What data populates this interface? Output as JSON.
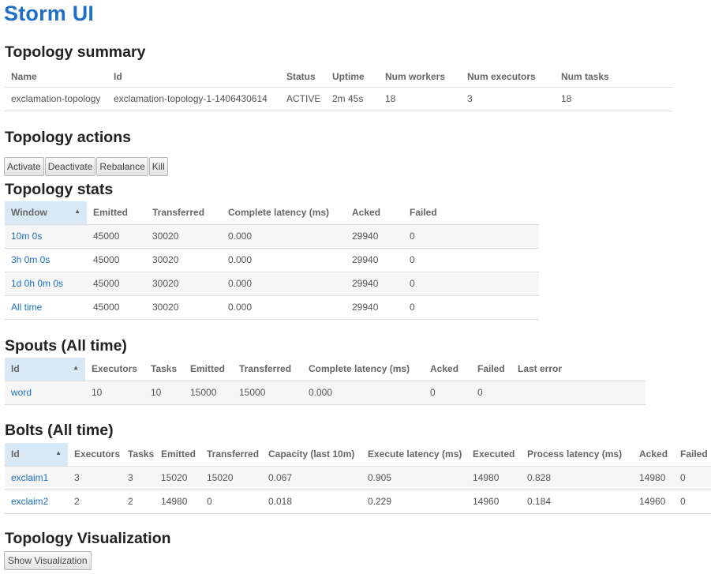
{
  "app": {
    "title": "Storm UI"
  },
  "topology_summary": {
    "title": "Topology summary",
    "columns": [
      "Name",
      "Id",
      "Status",
      "Uptime",
      "Num workers",
      "Num executors",
      "Num tasks"
    ],
    "row": [
      "exclamation-topology",
      "exclamation-topology-1-1406430614",
      "ACTIVE",
      "2m 45s",
      "18",
      "3",
      "18"
    ]
  },
  "topology_actions": {
    "title": "Topology actions",
    "buttons": [
      "Activate",
      "Deactivate",
      "Rebalance",
      "Kill"
    ]
  },
  "topology_stats": {
    "title": "Topology stats",
    "columns": [
      "Window",
      "Emitted",
      "Transferred",
      "Complete latency (ms)",
      "Acked",
      "Failed"
    ],
    "rows": [
      [
        "10m 0s",
        "45000",
        "30020",
        "0.000",
        "29940",
        "0"
      ],
      [
        "3h 0m 0s",
        "45000",
        "30020",
        "0.000",
        "29940",
        "0"
      ],
      [
        "1d 0h 0m 0s",
        "45000",
        "30020",
        "0.000",
        "29940",
        "0"
      ],
      [
        "All time",
        "45000",
        "30020",
        "0.000",
        "29940",
        "0"
      ]
    ]
  },
  "spouts": {
    "title": "Spouts (All time)",
    "columns": [
      "Id",
      "Executors",
      "Tasks",
      "Emitted",
      "Transferred",
      "Complete latency (ms)",
      "Acked",
      "Failed",
      "Last error"
    ],
    "rows": [
      [
        "word",
        "10",
        "10",
        "15000",
        "15000",
        "0.000",
        "0",
        "0",
        ""
      ]
    ]
  },
  "bolts": {
    "title": "Bolts (All time)",
    "columns": [
      "Id",
      "Executors",
      "Tasks",
      "Emitted",
      "Transferred",
      "Capacity (last 10m)",
      "Execute latency (ms)",
      "Executed",
      "Process latency (ms)",
      "Acked",
      "Failed"
    ],
    "rows": [
      [
        "exclaim1",
        "3",
        "3",
        "15020",
        "15020",
        "0.067",
        "0.905",
        "14980",
        "0.828",
        "14980",
        "0"
      ],
      [
        "exclaim2",
        "2",
        "2",
        "14980",
        "0",
        "0.018",
        "0.229",
        "14960",
        "0.184",
        "14960",
        "0"
      ]
    ]
  },
  "visualization": {
    "title": "Topology Visualization",
    "button": "Show Visualization"
  }
}
